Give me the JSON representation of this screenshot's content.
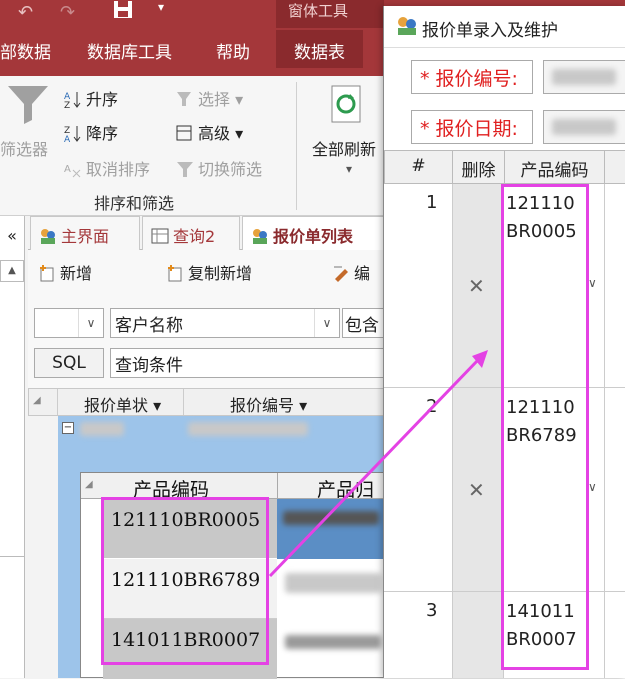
{
  "ribbon": {
    "tabs": [
      {
        "label": "部数据"
      },
      {
        "label": "数据库工具"
      },
      {
        "label": "帮助"
      },
      {
        "label": "数据表"
      },
      {
        "label": "窗体工具"
      }
    ],
    "filter_label": "筛选器",
    "sort_asc": "升序",
    "sort_desc": "降序",
    "clear_sort": "取消排序",
    "select": "选择",
    "advanced": "高级",
    "toggle_filter": "切换筛选",
    "group_label": "排序和筛选",
    "refresh_all": "全部刷新"
  },
  "nav_pane": {
    "collapse": "«",
    "scroll_up": "▲"
  },
  "doc_tabs": [
    {
      "label": "主界面"
    },
    {
      "label": "查询2"
    },
    {
      "label": "报价单列表"
    }
  ],
  "toolbar": {
    "new": "新增",
    "copy_new": "复制新增",
    "edit": "编",
    "field_combo": "客户名称",
    "op_combo": "包含",
    "sql_button": "SQL",
    "query_condition": "查询条件"
  },
  "main_grid": {
    "headers": [
      "报价单状",
      "报价编号"
    ],
    "sub_headers": [
      "产品编码",
      "产品归"
    ],
    "rows": [
      {
        "code": "121110BR0005"
      },
      {
        "code": "121110BR6789"
      },
      {
        "code": "141011BR0007"
      }
    ]
  },
  "popup": {
    "title": "报价单录入及维护",
    "quote_no_label": "* 报价编号:",
    "quote_date_label": "* 报价日期:",
    "table": {
      "headers": [
        "#",
        "删除",
        "产品编码"
      ],
      "rows": [
        {
          "num": "1",
          "code_line1": "121110",
          "code_line2": "BR0005"
        },
        {
          "num": "2",
          "code_line1": "121110",
          "code_line2": "BR6789"
        },
        {
          "num": "3",
          "code_line1": "141011",
          "code_line2": "BR0007"
        }
      ]
    }
  },
  "colors": {
    "ribbon": "#a4373a",
    "highlight": "#e442e4",
    "required": "#e02020"
  }
}
